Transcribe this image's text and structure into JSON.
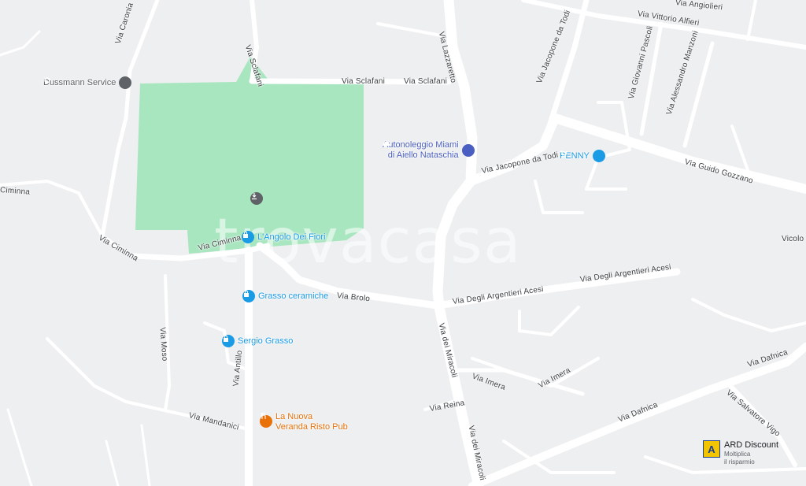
{
  "watermark": "trovacasa",
  "streets": [
    {
      "name": "Via Vittorio Alfieri"
    },
    {
      "name": "Via Angiolieri"
    },
    {
      "name": "Via Sclafani"
    },
    {
      "name": "Via Sclafani"
    },
    {
      "name": "Via Sclafani"
    },
    {
      "name": "Via Caronia"
    },
    {
      "name": "Via Lazzaretto"
    },
    {
      "name": "Via Jacopone da Todi"
    },
    {
      "name": "Via Jacopone da Todi"
    },
    {
      "name": "Via Giovanni Pascoli"
    },
    {
      "name": "Via Alessandro Manzoni"
    },
    {
      "name": "Via Guido Gozzano"
    },
    {
      "name": "Ciminna"
    },
    {
      "name": "Via Ciminna"
    },
    {
      "name": "Via Ciminna"
    },
    {
      "name": "Via Brolo"
    },
    {
      "name": "Via Degli Argentieri Acesi"
    },
    {
      "name": "Via Degli Argentieri Acesi"
    },
    {
      "name": "Vicolo"
    },
    {
      "name": "Via Moso"
    },
    {
      "name": "Via dei Miracoli"
    },
    {
      "name": "Via dei Miracoli"
    },
    {
      "name": "Via Imera"
    },
    {
      "name": "Via Imera"
    },
    {
      "name": "Via Antillo"
    },
    {
      "name": "Via Mandanici"
    },
    {
      "name": "Via Reina"
    },
    {
      "name": "Via Dafnica"
    },
    {
      "name": "Via Dafnica"
    },
    {
      "name": "Via Salvatore Vigo"
    }
  ],
  "pois": [
    {
      "name": "Dussmann Service",
      "icon": "pin-icon",
      "color": "#5f6368"
    },
    {
      "name": "Autonoleggio Miami\ndi Aiello Nataschia",
      "icon": "car-icon",
      "color": "#4a5fc1"
    },
    {
      "name": "PENNY",
      "icon": "cart-icon",
      "color": "#1a9be6"
    },
    {
      "name": "L'Angolo Dei Fiori",
      "icon": "shopping-bag-icon",
      "color": "#1a9be6"
    },
    {
      "name": "Grasso ceramiche",
      "icon": "shopping-bag-icon",
      "color": "#1a9be6"
    },
    {
      "name": "Sergio Grasso",
      "icon": "shopping-bag-icon",
      "color": "#1a9be6"
    },
    {
      "name": "La Nuova\nVeranda Risto Pub",
      "icon": "restaurant-icon",
      "color": "#e8710a"
    },
    {
      "name": "",
      "icon": "download-icon",
      "color": "#5f6368"
    }
  ],
  "ad": {
    "name": "ARD Discount",
    "line1": "Moltiplica",
    "line2": "il risparmio",
    "logo_letter": "A",
    "logo_color": "#f3c400"
  },
  "colors": {
    "park": "#a8e6bf",
    "road": "#ffffff",
    "background": "#eeeff1"
  }
}
